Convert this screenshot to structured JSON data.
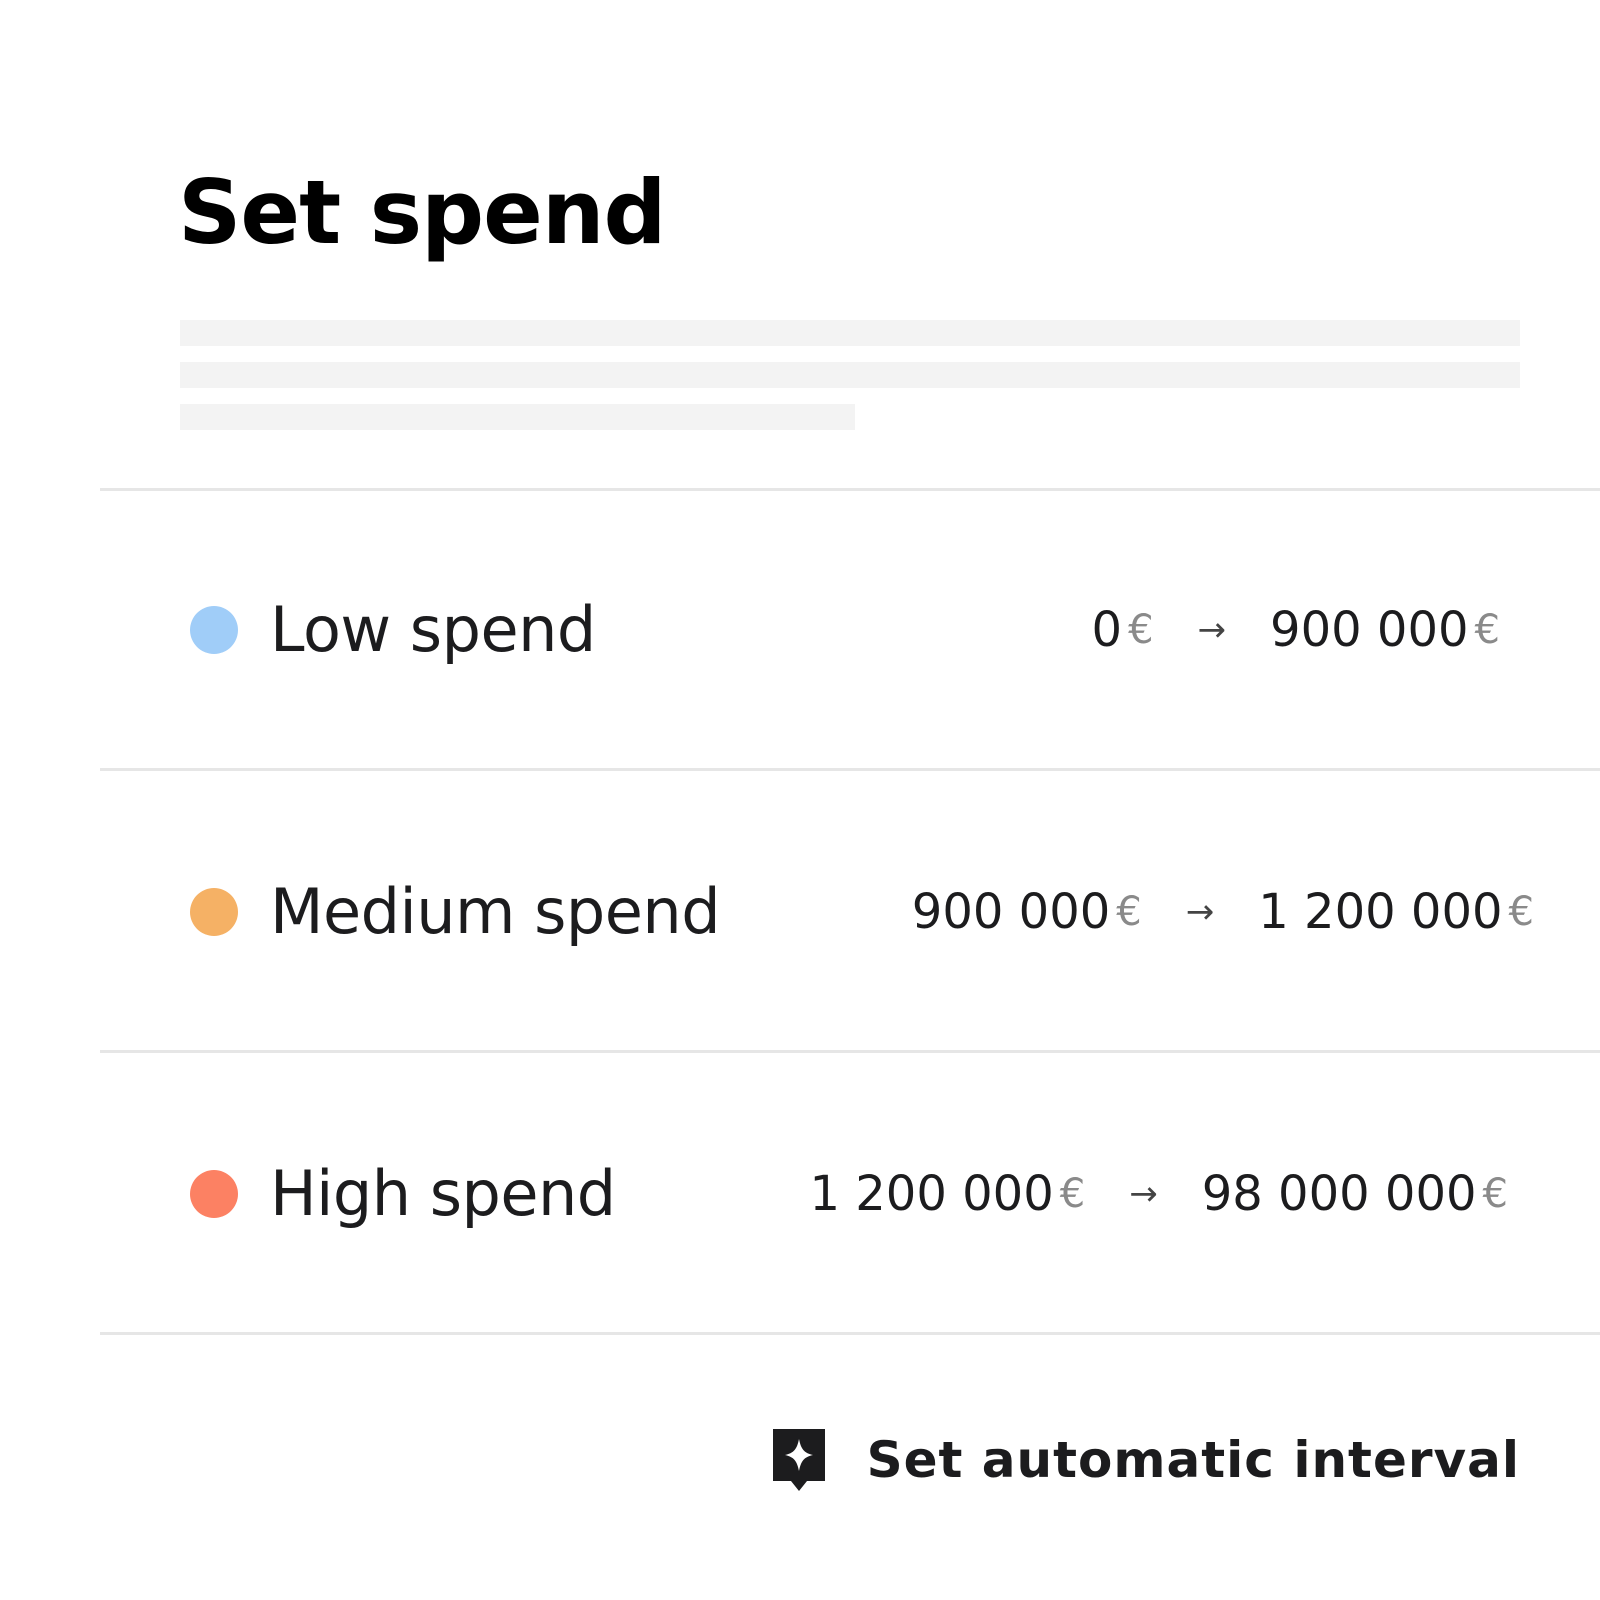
{
  "page": {
    "title": "Set spend"
  },
  "currency_symbol": "€",
  "arrow": "→",
  "tiers": [
    {
      "label": "Low spend",
      "color": "#a0cdf8",
      "from": "0",
      "to": "900 000"
    },
    {
      "label": "Medium spend",
      "color": "#f5b165",
      "from": "900 000",
      "to": "1 200 000"
    },
    {
      "label": "High spend",
      "color": "#fc8163",
      "from": "1 200 000",
      "to": "98 000 000"
    }
  ],
  "actions": {
    "auto_interval_label": "Set automatic interval",
    "auto_interval_icon": "sparkle-icon"
  }
}
